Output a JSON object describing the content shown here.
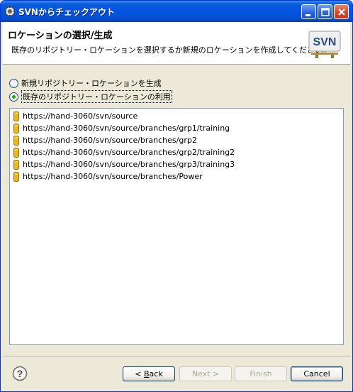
{
  "window": {
    "title": "SVNからチェックアウト"
  },
  "header": {
    "title": "ロケーションの選択/生成",
    "description": "既存のリポジトリー・ロケーションを選択するか新規のロケーションを作成してください。",
    "logo_text": "SVN"
  },
  "options": {
    "create_new": {
      "label": "新規リポジトリー・ロケーションを生成",
      "checked": false
    },
    "use_existing": {
      "label": "既存のリポジトリー・ロケーションの利用",
      "checked": true
    }
  },
  "repositories": [
    "https://hand-3060/svn/source",
    "https://hand-3060/svn/source/branches/grp1/training",
    "https://hand-3060/svn/source/branches/grp2",
    "https://hand-3060/svn/source/branches/grp2/training2",
    "https://hand-3060/svn/source/branches/grp3/training3",
    "https://hand-3060/svn/source/branches/Power"
  ],
  "buttons": {
    "back": {
      "prefix": "< ",
      "mnemonic": "B",
      "rest": "ack",
      "enabled": true
    },
    "next": {
      "label": "Next >",
      "enabled": false
    },
    "finish": {
      "label": "Finish",
      "enabled": false
    },
    "cancel": {
      "label": "Cancel",
      "enabled": true
    }
  },
  "colors": {
    "titlebar": "#0554e3",
    "dialog_bg": "#ece9d8",
    "repo_icon": "#e8b820",
    "radio_dot": "#21a121"
  },
  "icons": {
    "app": "gear-icon",
    "repo": "repository-icon",
    "help": "help-icon"
  }
}
